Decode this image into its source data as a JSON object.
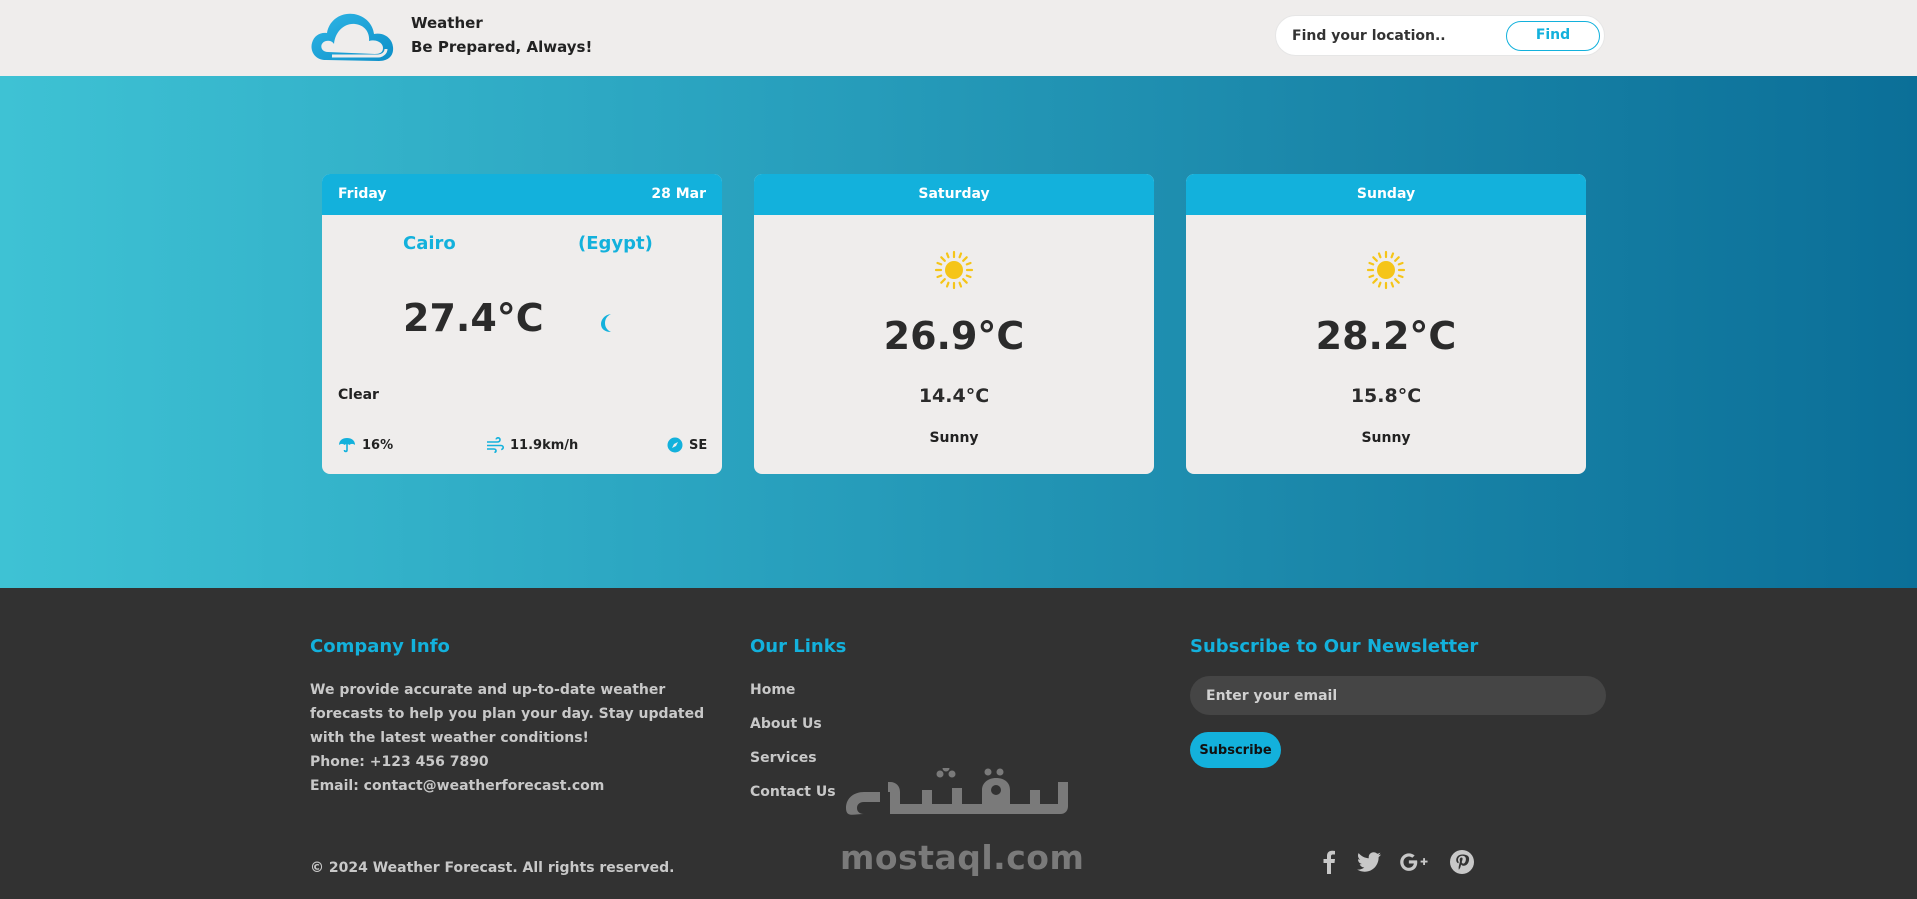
{
  "header": {
    "brand_name": "Weather",
    "brand_tagline": "Be Prepared, Always!",
    "search_placeholder": "Find your location..",
    "find_label": "Find"
  },
  "colors": {
    "accent": "#13b1dc",
    "card_bg": "#efedec",
    "footer_bg": "#323232",
    "sun": "#f5c518"
  },
  "today": {
    "day": "Friday",
    "date": "28 Mar",
    "city": "Cairo",
    "country": "(Egypt)",
    "temperature": "27.4°C",
    "icon": "moon-icon",
    "condition": "Clear",
    "humidity": "16%",
    "wind_speed": "11.9km/h",
    "wind_direction": "SE"
  },
  "forecast": [
    {
      "day": "Saturday",
      "icon": "sun-icon",
      "max": "26.9°C",
      "min": "14.4°C",
      "condition": "Sunny"
    },
    {
      "day": "Sunday",
      "icon": "sun-icon",
      "max": "28.2°C",
      "min": "15.8°C",
      "condition": "Sunny"
    }
  ],
  "footer": {
    "company_heading": "Company Info",
    "company_text": "We provide accurate and up-to-date weather forecasts to help you plan your day. Stay updated with the latest weather conditions!",
    "phone": "Phone: +123 456 7890",
    "email": "Email: contact@weatherforecast.com",
    "links_heading": "Our Links",
    "links": [
      "Home",
      "About Us",
      "Services",
      "Contact Us"
    ],
    "newsletter_heading": "Subscribe to Our Newsletter",
    "email_placeholder": "Enter your email",
    "subscribe_label": "Subscribe",
    "copyright": "© 2024 Weather Forecast. All rights reserved.",
    "social": [
      "facebook-icon",
      "twitter-icon",
      "google-plus-icon",
      "pinterest-icon"
    ]
  },
  "watermark": {
    "text": "mostaql.com",
    "arabic": "مستقل"
  }
}
